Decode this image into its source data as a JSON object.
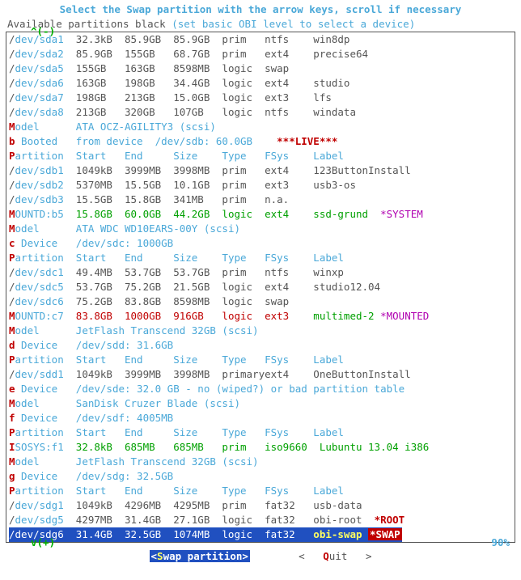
{
  "title": "Select the Swap partition with the arrow keys, scroll if necessary",
  "subtitle_avail": "Available partitions black",
  "subtitle_hint": "(set basic OBI level to select a device)",
  "scroll_up": "^(-)",
  "scroll_down": "v(+)",
  "scroll_pct": "90%",
  "hdr": {
    "start": "Start",
    "end": "End",
    "size": "Size",
    "type": "Type",
    "fsys": "FSys",
    "label": "Label"
  },
  "sda": [
    {
      "dev": "dev/sda1",
      "start": "32.3kB",
      "end": "85.9GB",
      "size": "85.9GB",
      "type": "prim",
      "fsys": "ntfs",
      "label": "win8dp"
    },
    {
      "dev": "dev/sda2",
      "start": "85.9GB",
      "end": "155GB",
      "size": "68.7GB",
      "type": "prim",
      "fsys": "ext4",
      "label": "precise64"
    },
    {
      "dev": "dev/sda5",
      "start": "155GB",
      "end": "163GB",
      "size": "8598MB",
      "type": "logic",
      "fsys": "swap",
      "label": ""
    },
    {
      "dev": "dev/sda6",
      "start": "163GB",
      "end": "198GB",
      "size": "34.4GB",
      "type": "logic",
      "fsys": "ext4",
      "label": "studio"
    },
    {
      "dev": "dev/sda7",
      "start": "198GB",
      "end": "213GB",
      "size": "15.0GB",
      "type": "logic",
      "fsys": "ext3",
      "label": "lfs"
    },
    {
      "dev": "dev/sda8",
      "start": "213GB",
      "end": "320GB",
      "size": "107GB",
      "type": "logic",
      "fsys": "ntfs",
      "label": "windata"
    }
  ],
  "model_a": "ATA OCZ-AGILITY3 (scsi)",
  "booted_line": {
    "letter": "b",
    "word": "Booted",
    "from": "from device",
    "dev": "/dev/sdb: 60.0GB",
    "live": "***LIVE***"
  },
  "sdb": [
    {
      "dev": "dev/sdb1",
      "start": "1049kB",
      "end": "3999MB",
      "size": "3998MB",
      "type": "prim",
      "fsys": "ext4",
      "label": "123ButtonInstall"
    },
    {
      "dev": "dev/sdb2",
      "start": "5370MB",
      "end": "15.5GB",
      "size": "10.1GB",
      "type": "prim",
      "fsys": "ext3",
      "label": "usb3-os"
    },
    {
      "dev": "dev/sdb3",
      "start": "15.5GB",
      "end": "15.8GB",
      "size": "341MB",
      "type": "prim",
      "fsys": "n.a.",
      "label": ""
    }
  ],
  "mount_b5": {
    "tag": "OUNTD:b5",
    "start": "15.8GB",
    "end": "60.0GB",
    "size": "44.2GB",
    "type": "logic",
    "fsys": "ext4",
    "label": "ssd-grund",
    "badge": "*SYSTEM"
  },
  "model_b": "ATA WDC WD10EARS-00Y (scsi)",
  "device_c": {
    "letter": "c",
    "word": "Device",
    "dev": "/dev/sdc: 1000GB"
  },
  "sdc": [
    {
      "dev": "dev/sdc1",
      "start": "49.4MB",
      "end": "53.7GB",
      "size": "53.7GB",
      "type": "prim",
      "fsys": "ntfs",
      "label": "winxp"
    },
    {
      "dev": "dev/sdc5",
      "start": "53.7GB",
      "end": "75.2GB",
      "size": "21.5GB",
      "type": "logic",
      "fsys": "ext4",
      "label": "studio12.04"
    },
    {
      "dev": "dev/sdc6",
      "start": "75.2GB",
      "end": "83.8GB",
      "size": "8598MB",
      "type": "logic",
      "fsys": "swap",
      "label": ""
    }
  ],
  "mount_c7": {
    "tag": "OUNTD:c7",
    "start": "83.8GB",
    "end": "1000GB",
    "size": "916GB",
    "type": "logic",
    "fsys": "ext3",
    "label": "multimed-2",
    "badge": "*MOUNTED"
  },
  "model_d": "JetFlash Transcend 32GB (scsi)",
  "device_d": {
    "letter": "d",
    "word": "Device",
    "dev": "/dev/sdd: 31.6GB"
  },
  "sdd": [
    {
      "dev": "dev/sdd1",
      "start": "1049kB",
      "end": "3999MB",
      "size": "3998MB",
      "type": "primary",
      "fsys": "ext4",
      "label": "OneButtonInstall"
    }
  ],
  "device_e": {
    "letter": "e",
    "word": "Device",
    "dev": "/dev/sde: 32.0 GB - no (wiped?) or bad partition table"
  },
  "model_f": "SanDisk Cruzer Blade (scsi)",
  "device_f": {
    "letter": "f",
    "word": "Device",
    "dev": "/dev/sdf: 4005MB"
  },
  "iso_f1": {
    "tag": "SOSYS:f1",
    "start": "32.8kB",
    "end": "685MB",
    "size": "685MB",
    "type": "prim",
    "fsys": "iso9660",
    "label": "Lubuntu 13.04 i386"
  },
  "model_g": "JetFlash Transcend 32GB (scsi)",
  "device_g": {
    "letter": "g",
    "word": "Device",
    "dev": "/dev/sdg: 32.5GB"
  },
  "sdg": [
    {
      "dev": "dev/sdg1",
      "start": "1049kB",
      "end": "4296MB",
      "size": "4295MB",
      "type": "prim",
      "fsys": "fat32",
      "label": "usb-data"
    },
    {
      "dev": "dev/sdg5",
      "start": "4297MB",
      "end": "31.4GB",
      "size": "27.1GB",
      "type": "logic",
      "fsys": "fat32",
      "label": "obi-root",
      "badge": "*ROOT"
    }
  ],
  "sel": {
    "dev": "/dev/sdg6",
    "start": "31.4GB",
    "end": "32.5GB",
    "size": "1074MB",
    "type": "logic",
    "fsys": "fat32",
    "label": "obi-swap",
    "badge": "*SWAP"
  },
  "btn_swap_lt": "<",
  "btn_swap_s": "S",
  "btn_swap_rest": "wap partition",
  "btn_swap_gt": ">",
  "btn_quit_lt": "<",
  "btn_quit_q": "Q",
  "btn_quit_rest": "uit",
  "btn_quit_gt": ">",
  "words": {
    "Model": "odel",
    "M": "M",
    "Partition": "artition",
    "P": "P",
    "I": "I"
  }
}
